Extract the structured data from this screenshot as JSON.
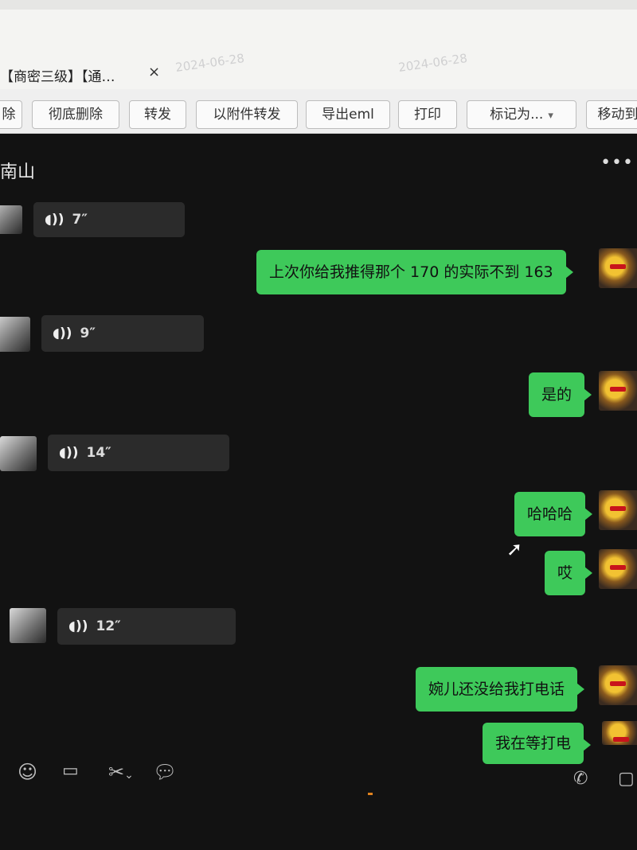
{
  "mail": {
    "tab_title": "【商密三级】【通…",
    "tab_close": "×",
    "watermark": "2024-06-28",
    "toolbar": [
      {
        "label": "除"
      },
      {
        "label": "彻底删除"
      },
      {
        "label": "转发"
      },
      {
        "label": "以附件转发"
      },
      {
        "label": "导出eml"
      },
      {
        "label": "打印"
      },
      {
        "label": "标记为..."
      },
      {
        "label": "移动到"
      }
    ]
  },
  "chat": {
    "title": "南山",
    "more_icon": "•••",
    "voice_messages": [
      {
        "duration": "7″"
      },
      {
        "duration": "9″"
      },
      {
        "duration": "14″"
      },
      {
        "duration": "12″"
      }
    ],
    "sent_messages": [
      {
        "text": "上次你给我推得那个 170 的实际不到 163"
      },
      {
        "text": "是的"
      },
      {
        "text": "哈哈哈"
      },
      {
        "text": "哎"
      },
      {
        "text": "婉儿还没给我打电话"
      },
      {
        "text": "我在等打电"
      }
    ],
    "input_icons": [
      "emoji-icon",
      "folder-icon",
      "scissors-icon",
      "chat-bubble-icon"
    ],
    "call_icons": [
      "phone-icon",
      "video-icon"
    ]
  }
}
